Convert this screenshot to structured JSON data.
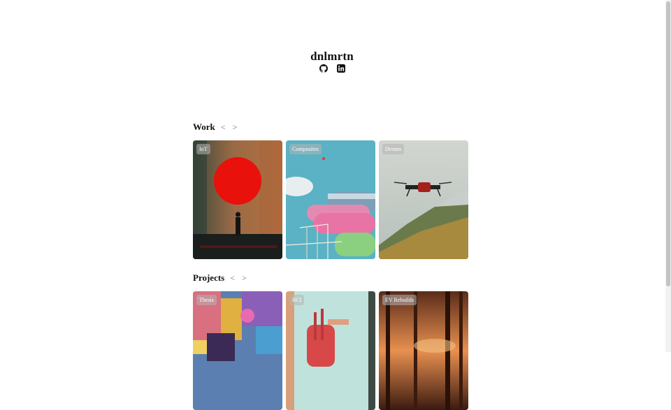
{
  "site": {
    "title": "dnlmrtn",
    "social_icons": [
      "github-icon",
      "linkedin-icon"
    ]
  },
  "sections": [
    {
      "title": "Work",
      "prev": "<",
      "next": ">",
      "cards": [
        {
          "label": "IoT"
        },
        {
          "label": "Composites"
        },
        {
          "label": "Drones"
        }
      ]
    },
    {
      "title": "Projects",
      "prev": "<",
      "next": ">",
      "cards": [
        {
          "label": "Thesis"
        },
        {
          "label": "BCI"
        },
        {
          "label": "EV Rebuilds"
        }
      ]
    }
  ]
}
